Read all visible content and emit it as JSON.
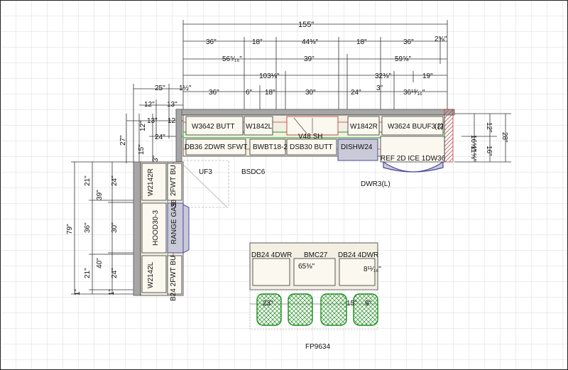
{
  "dimensions": {
    "overall_width": "155\"",
    "row1": [
      "36\"",
      "18\"",
      "44⅜\"",
      "18\"",
      "36\"",
      "2⅝\""
    ],
    "row2": [
      "56⁵⁄₁₆\"",
      "39\"",
      "59⅝\""
    ],
    "row3": [
      "103⅛\"",
      "32⅜\"",
      "19\""
    ],
    "row4": [
      "36\"",
      "6\"",
      "18\"",
      "30\"",
      "24\"",
      "3\"",
      "36¹³⁄₁₆\""
    ],
    "left_top": [
      "25\"",
      "1½\"",
      "12\"",
      "13\"",
      "13\"",
      "12\"",
      "24\""
    ],
    "left_side": [
      "27\"",
      "15\"",
      "12\"",
      "3\""
    ],
    "right_side": [
      "16⅝\"",
      "11⅝\"",
      "12\"",
      "16\"",
      "28\""
    ],
    "left_column": [
      "79\"",
      "21\"",
      "39\"",
      "24\"",
      "36\"",
      "30\"",
      "40\"",
      "21\"",
      "24\"",
      "1\"",
      "1\""
    ],
    "island": [
      "65⅜\"",
      "8¹¹⁄₁₆\"",
      "23\"",
      "15\"",
      "9\""
    ]
  },
  "labels": {
    "w3642": "W3642 BUTT",
    "w1842l": "W1842L",
    "w1842r": "W1842R",
    "w3624": "W3624 BUUF3 (2",
    "w3624b": "(2)",
    "v48": "V48 SH",
    "db36": "DB36 2DWR SFWT",
    "bwbt": "BWBT18-2",
    "dsb30": "DSB30 BUTT",
    "dishw": "DISHW24",
    "ref": "REF 2D ICE 1DW36",
    "dwr3": "DWR3(L)",
    "uf3": "UF3",
    "bsdc6": "BSDC6",
    "w2142r": "W2142R",
    "b2fwt_top": "2FWT BU",
    "hood": "HOOD30-3",
    "range": "RANGE GAS",
    "range_num": "30",
    "w2142l": "W2142L",
    "b24_bottom": "B24 2FWT BU",
    "db24a": "DB24 4DWR",
    "bmc27": "BMC27",
    "db24b": "DB24 4DWR",
    "fp": "FP9634"
  },
  "colors": {
    "grid": "#d9d9d9",
    "wall": "#a6a6a6",
    "cabinet_fill": "#f3efe3",
    "counter_fill": "#c9c9d8",
    "appliance": "#4a4aa0",
    "red_line": "#c23b3b",
    "green_line": "#3fae3f",
    "stool": "#1a8f1a",
    "dim_line": "#333333"
  }
}
